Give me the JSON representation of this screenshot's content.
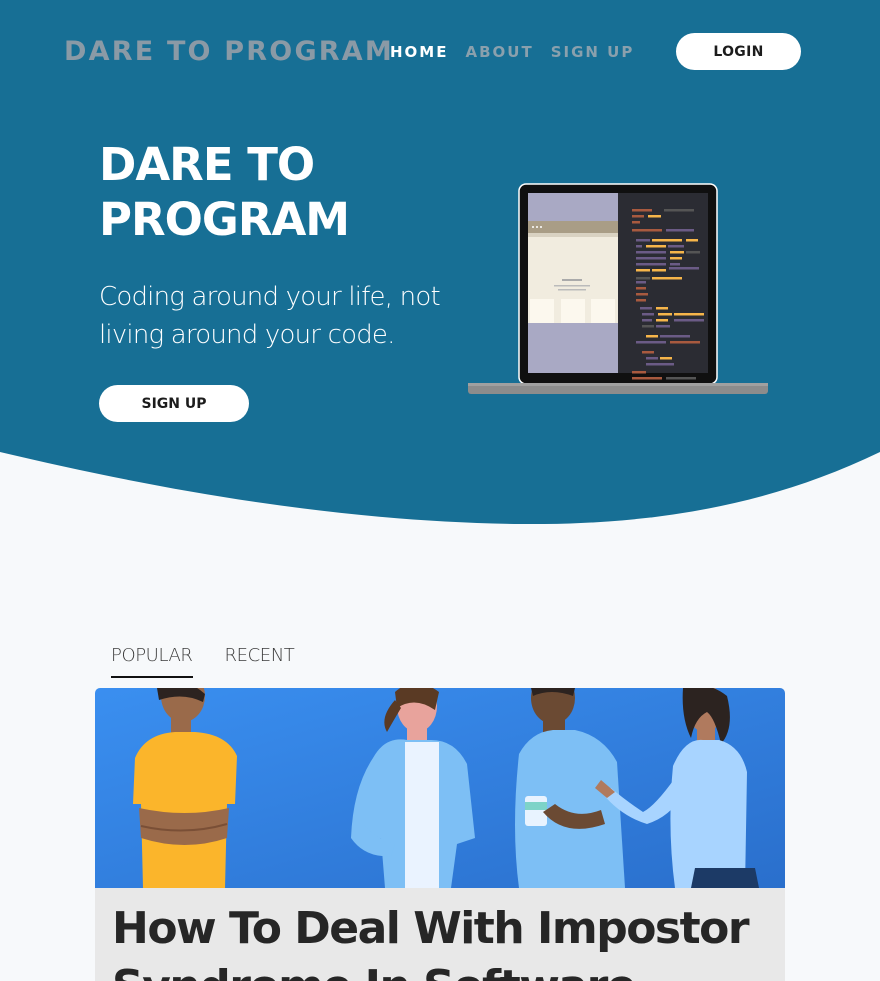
{
  "colors": {
    "hero_bg": "#176f95",
    "page_bg": "#f7f9fb",
    "button_bg": "#ffffff",
    "nav_inactive": "#8aa0ad",
    "logo": "#8a9aa6"
  },
  "header": {
    "logo": "DARE TO PROGRAM",
    "nav": [
      {
        "label": "HOME",
        "active": true
      },
      {
        "label": "ABOUT",
        "active": false
      },
      {
        "label": "SIGN UP",
        "active": false
      }
    ],
    "login_label": "LOGIN"
  },
  "hero": {
    "title": "DARE TO PROGRAM",
    "subtitle": "Coding around your life, not living around your code.",
    "signup_label": "SIGN UP",
    "illustration": "laptop-with-code"
  },
  "tabs": [
    {
      "label": "POPULAR",
      "active": true
    },
    {
      "label": "RECENT",
      "active": false
    }
  ],
  "article": {
    "image": "people-talking-illustration",
    "title": "How To Deal With Impostor Syndrome In Software"
  }
}
